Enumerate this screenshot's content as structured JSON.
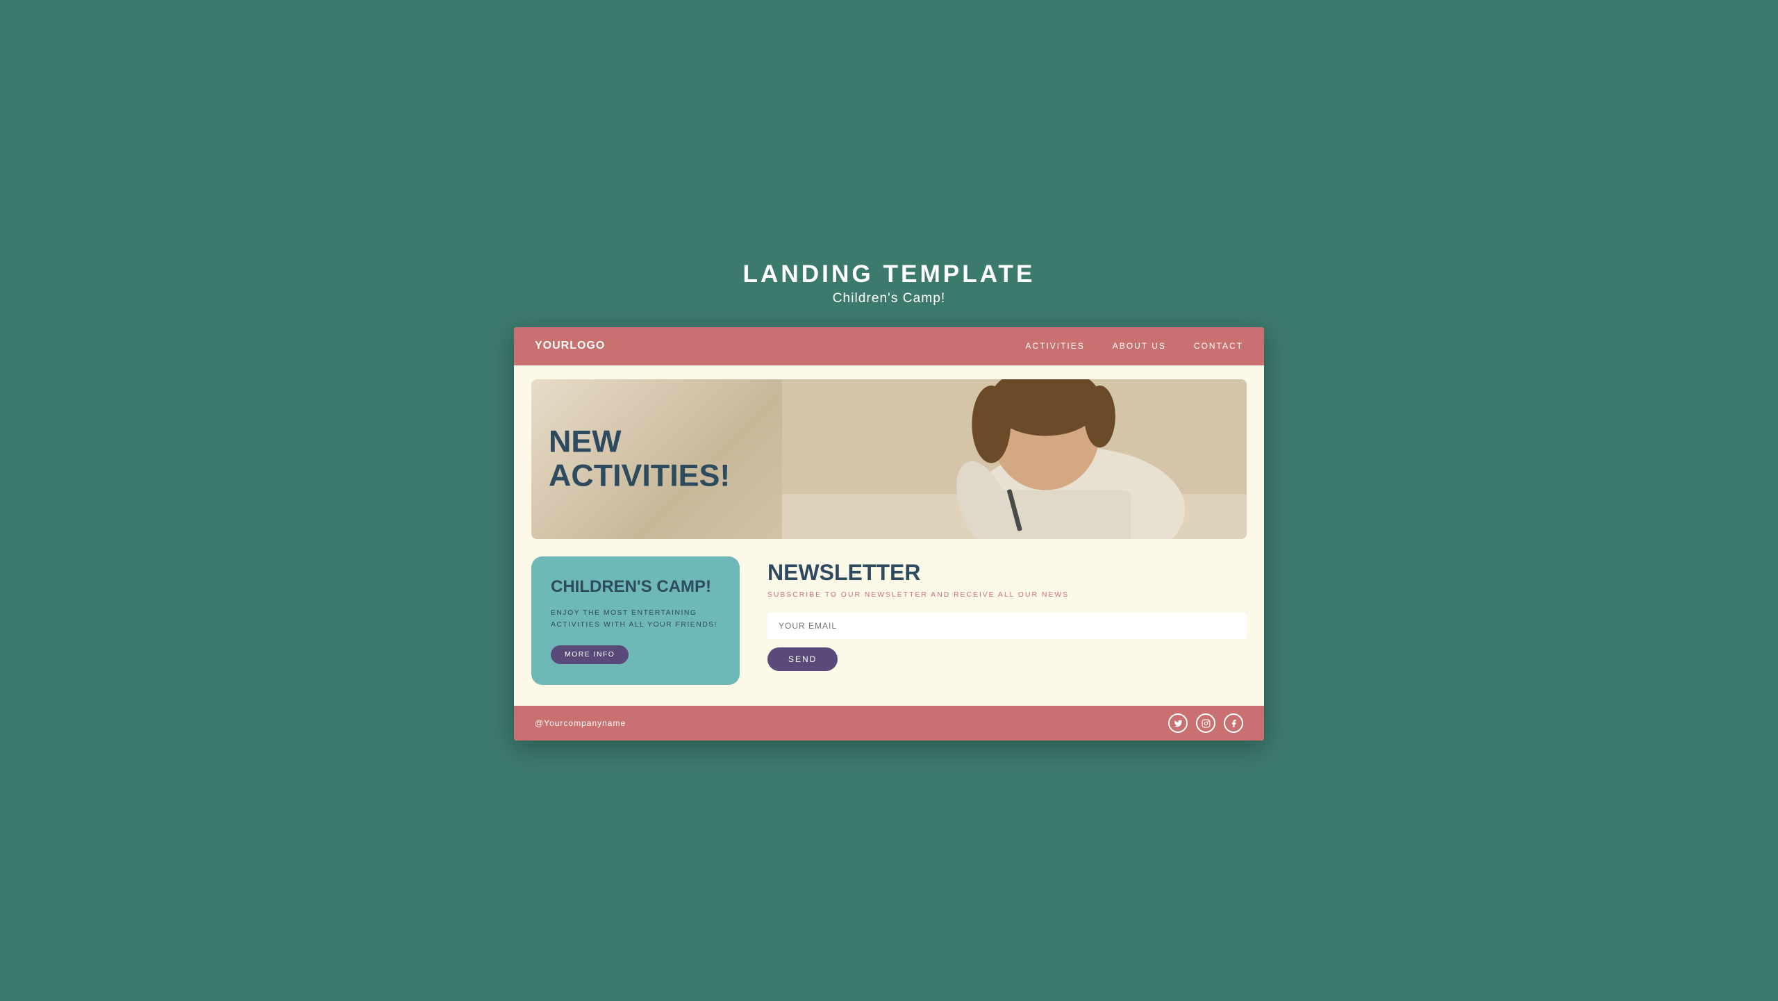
{
  "page": {
    "title": "LANDING TEMPLATE",
    "subtitle": "Children's Camp!"
  },
  "navbar": {
    "logo_text": "YOUR",
    "logo_bold": "LOGO",
    "links": [
      {
        "label": "ACTIVITIES",
        "id": "activities"
      },
      {
        "label": "ABOUT US",
        "id": "about-us"
      },
      {
        "label": "CONTACT",
        "id": "contact"
      }
    ]
  },
  "hero": {
    "line1": "NEW",
    "line2": "ACTIVITIES!"
  },
  "camp_card": {
    "title": "CHILDREN'S CAMP!",
    "description": "ENJOY THE MOST ENTERTAINING\nACTIVITIES WITH ALL YOUR FRIENDS!",
    "button_label": "MORE INFO"
  },
  "newsletter": {
    "title": "NEWSLETTER",
    "subtitle": "SUBSCRIBE TO OUR NEWSLETTER AND RECEIVE ALL OUR NEWS",
    "email_placeholder": "YOUR EMAIL",
    "send_label": "SEND"
  },
  "footer": {
    "company": "@Yourcompanyname",
    "social": [
      "twitter",
      "instagram",
      "facebook"
    ]
  }
}
